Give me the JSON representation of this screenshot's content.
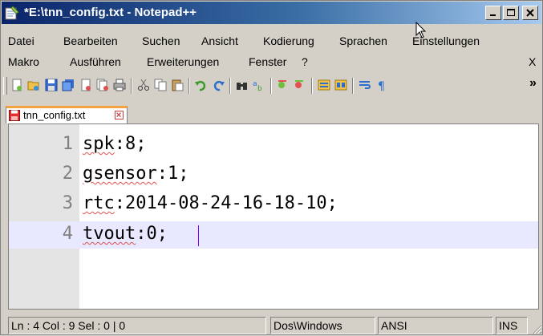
{
  "window": {
    "title": "*E:\\tnn_config.txt - Notepad++",
    "controls": {
      "minimize": "minimize",
      "maximize": "maximize",
      "close": "close"
    }
  },
  "menu": {
    "row1": [
      "Datei",
      "Bearbeiten",
      "Suchen",
      "Ansicht",
      "Kodierung",
      "Sprachen",
      "Einstellungen"
    ],
    "row2": [
      "Makro",
      "Ausführen",
      "Erweiterungen",
      "Fenster",
      "?"
    ],
    "close_doc": "X"
  },
  "toolbar": {
    "icons": [
      "new-file-icon",
      "open-file-icon",
      "save-icon",
      "save-all-icon",
      "close-icon",
      "close-all-icon",
      "print-icon",
      "cut-icon",
      "copy-icon",
      "paste-icon",
      "undo-icon",
      "redo-icon",
      "find-icon",
      "replace-icon",
      "zoom-in-icon",
      "zoom-out-icon",
      "sync-v-icon",
      "sync-h-icon",
      "wrap-icon",
      "show-all-chars-icon"
    ],
    "overflow": "»"
  },
  "tabs": [
    {
      "label": "tnn_config.txt",
      "modified": true
    }
  ],
  "editor": {
    "lines": [
      {
        "num": "1",
        "key": "spk",
        "rest": ":8;"
      },
      {
        "num": "2",
        "key": "gsensor",
        "rest": ":1;"
      },
      {
        "num": "3",
        "key": "rtc",
        "rest": ":2014-08-24-16-18-10;"
      },
      {
        "num": "4",
        "key": "tvout",
        "rest": ":0;"
      }
    ],
    "current_line": 4
  },
  "status": {
    "position": "Ln : 4    Col : 9    Sel : 0 | 0",
    "eol": "Dos\\Windows",
    "encoding": "ANSI",
    "mode": "INS"
  },
  "colors": {
    "accent_title": "#0a246a",
    "current_line": "#e8e8ff",
    "caret": "#8000ff",
    "gutter": "#e4e4e4"
  }
}
